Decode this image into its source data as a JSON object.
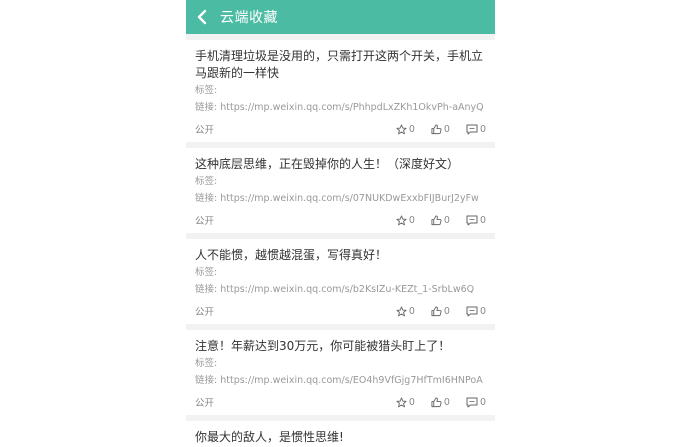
{
  "header": {
    "title": "云端收藏",
    "back_icon": "chevron-left-icon",
    "bg": "#4cbba3"
  },
  "labels": {
    "tags": "标签:",
    "link_prefix": "链接: "
  },
  "articles": [
    {
      "title": "手机清理垃圾是没用的，只需打开这两个开关，手机立马跟新的一样快",
      "link": "https://mp.weixin.qq.com/s/PhhpdLxZKh1OkvPh-aAnyQ",
      "visibility": "公开",
      "stars": "0",
      "likes": "0",
      "comments": "0"
    },
    {
      "title": "这种底层思维，正在毁掉你的人生！（深度好文）",
      "link": "https://mp.weixin.qq.com/s/07NUKDwExxbFIJBurJ2yFw",
      "visibility": "公开",
      "stars": "0",
      "likes": "0",
      "comments": "0"
    },
    {
      "title": "人不能惯，越惯越混蛋，写得真好！",
      "link": "https://mp.weixin.qq.com/s/b2KsIZu-KEZt_1-SrbLw6Q",
      "visibility": "公开",
      "stars": "0",
      "likes": "0",
      "comments": "0"
    },
    {
      "title": "注意！年薪达到30万元，你可能被猎头盯上了！",
      "link": "https://mp.weixin.qq.com/s/EO4h9VfGjg7HfTmI6HNPoA",
      "visibility": "公开",
      "stars": "0",
      "likes": "0",
      "comments": "0"
    },
    {
      "title": "你最大的敌人，是惯性思维!",
      "link": "",
      "visibility": "",
      "stars": "",
      "likes": "",
      "comments": ""
    }
  ]
}
